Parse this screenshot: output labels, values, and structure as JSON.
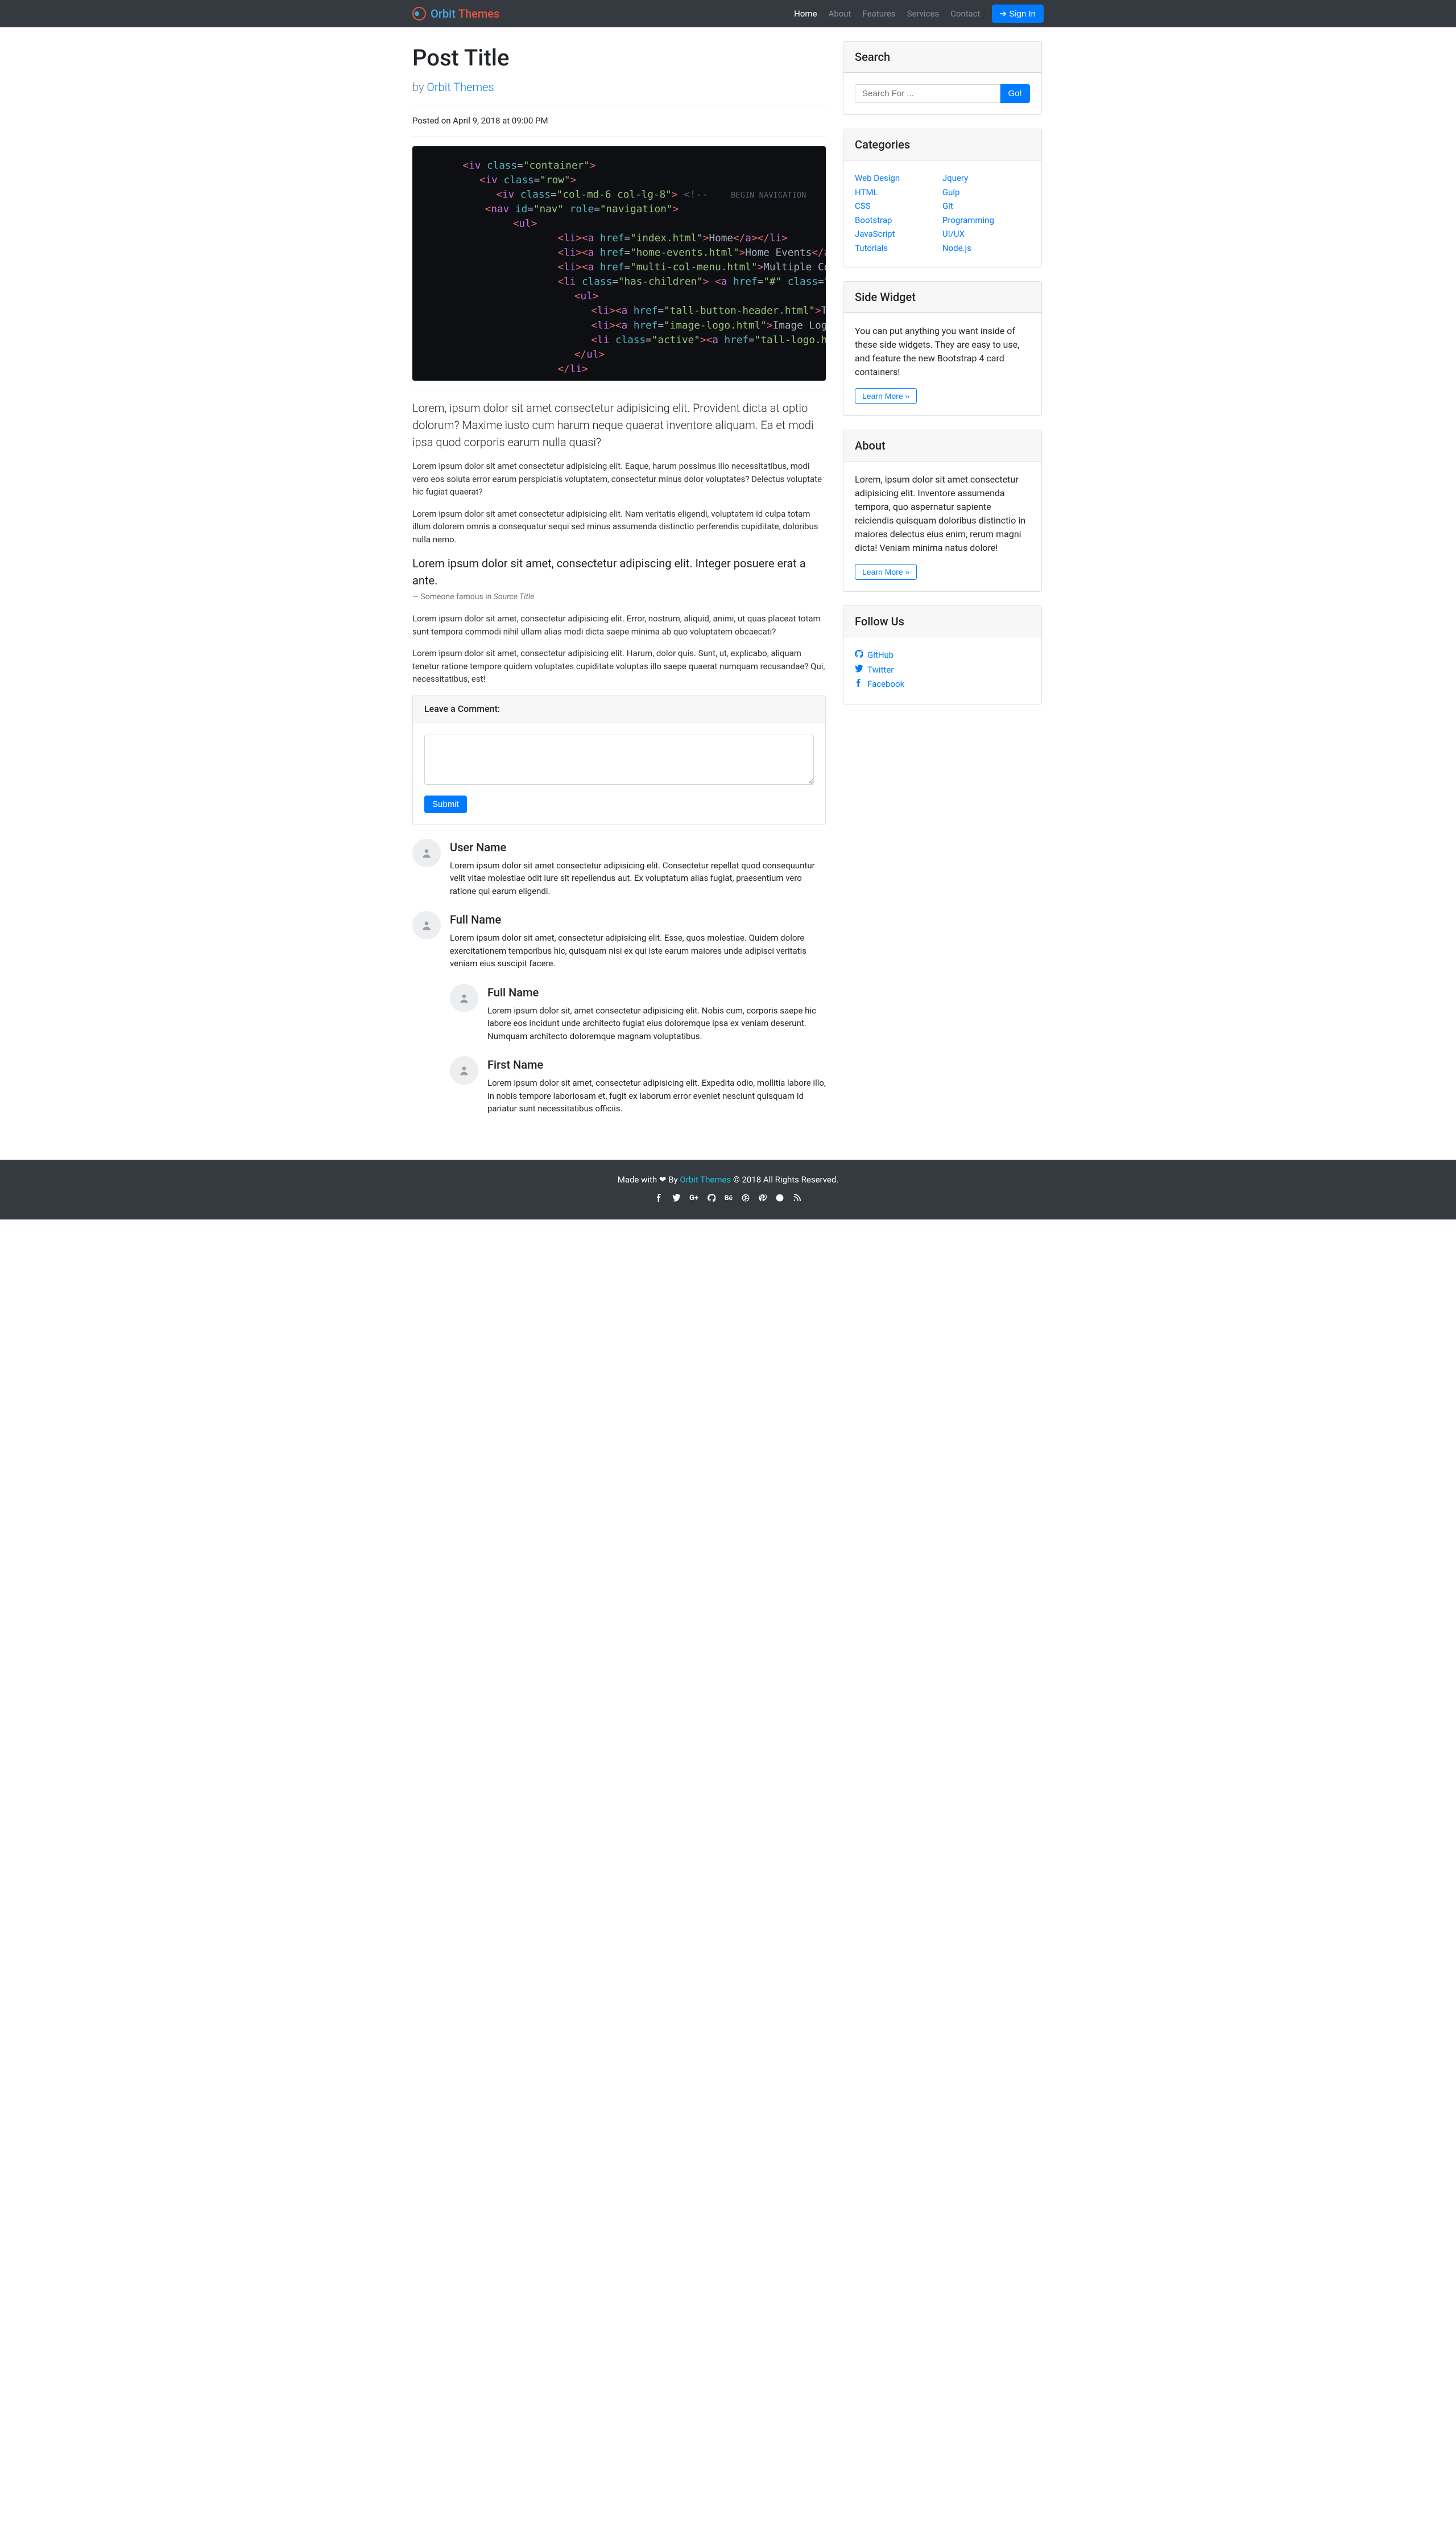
{
  "brand": {
    "orbit": "Orbit",
    "themes": "Themes"
  },
  "nav": {
    "items": [
      {
        "label": "Home",
        "active": true
      },
      {
        "label": "About",
        "active": false
      },
      {
        "label": "Features",
        "active": false
      },
      {
        "label": "Services",
        "active": false
      },
      {
        "label": "Contact",
        "active": false
      }
    ],
    "signin": "Sign In"
  },
  "post": {
    "title": "Post Title",
    "by_prefix": "by ",
    "author": "Orbit Themes",
    "posted": "Posted on April 9, 2018 at 09:00 PM",
    "lead": "Lorem, ipsum dolor sit amet consectetur adipisicing elit. Provident dicta at optio dolorum? Maxime iusto cum harum neque quaerat inventore aliquam. Ea et modi ipsa quod corporis earum nulla quasi?",
    "p1": "Lorem ipsum dolor sit amet consectetur adipisicing elit. Eaque, harum possimus illo necessitatibus, modi vero eos soluta error earum perspiciatis voluptatem, consectetur minus dolor voluptates? Delectus voluptate hic fugiat quaerat?",
    "p2": "Lorem ipsum dolor sit amet consectetur adipisicing elit. Nam veritatis eligendi, voluptatem id culpa totam illum dolorem omnis a consequatur sequi sed minus assumenda distinctio perferendis cupiditate, doloribus nulla nemo.",
    "bq": "Lorem ipsum dolor sit amet, consectetur adipiscing elit. Integer posuere erat a ante.",
    "bq_prefix": "Someone famous in ",
    "bq_cite": "Source Title",
    "p3": "Lorem ipsum dolor sit amet, consectetur adipisicing elit. Error, nostrum, aliquid, animi, ut quas placeat totam sunt tempora commodi nihil ullam alias modi dicta saepe minima ab quo voluptatem obcaecati?",
    "p4": "Lorem ipsum dolor sit amet, consectetur adipisicing elit. Harum, dolor quis. Sunt, ut, explicabo, aliquam tenetur ratione tempore quidem voluptates cupiditate voluptas illo saepe quaerat numquam recusandae? Qui, necessitatibus, est!"
  },
  "comment_form": {
    "header": "Leave a Comment:",
    "submit": "Submit"
  },
  "comments": [
    {
      "name": "User Name",
      "text": "Lorem ipsum dolor sit amet consectetur adipisicing elit. Consectetur repellat quod consequuntur velit vitae molestiae odit iure sit repellendus aut. Ex voluptatum alias fugiat, praesentium vero ratione qui earum eligendi.",
      "replies": []
    },
    {
      "name": "Full Name",
      "text": "Lorem ipsum dolor sit amet, consectetur adipisicing elit. Esse, quos molestiae. Quidem dolore exercitationem temporibus hic, quisquam nisi ex qui iste earum maiores unde adipisci veritatis veniam eius suscipit facere.",
      "replies": [
        {
          "name": "Full Name",
          "text": "Lorem ipsum dolor sit, amet consectetur adipisicing elit. Nobis cum, corporis saepe hic labore eos incidunt unde architecto fugiat eius doloremque ipsa ex veniam deserunt. Numquam architecto doloremque magnam voluptatibus."
        },
        {
          "name": "First Name",
          "text": "Lorem ipsum dolor sit amet, consectetur adipisicing elit. Expedita odio, mollitia labore illo, in nobis tempore laboriosam et, fugit ex laborum error eveniet nesciunt quisquam id pariatur sunt necessitatibus officiis."
        }
      ]
    }
  ],
  "search": {
    "header": "Search",
    "placeholder": "Search For ...",
    "go": "Go!"
  },
  "categories": {
    "header": "Categories",
    "col1": [
      "Web Design",
      "HTML",
      "CSS",
      "Bootstrap",
      "JavaScript",
      "Tutorials"
    ],
    "col2": [
      "Jquery",
      "Gulp",
      "Git",
      "Programming",
      "UI/UX",
      "Node.js"
    ]
  },
  "widget": {
    "header": "Side Widget",
    "text": "You can put anything you want inside of these side widgets. They are easy to use, and feature the new Bootstrap 4 card containers!",
    "learn": "Learn More »"
  },
  "about": {
    "header": "About",
    "text": "Lorem, ipsum dolor sit amet consectetur adipisicing elit. Inventore assumenda tempora, quo aspernatur sapiente reiciendis quisquam doloribus distinctio in maiores delectus eius enim, rerum magni dicta! Veniam minima natus dolore!",
    "learn": "Learn More »"
  },
  "follow": {
    "header": "Follow Us",
    "items": [
      {
        "icon": "github",
        "label": "GitHub"
      },
      {
        "icon": "twitter",
        "label": "Twitter"
      },
      {
        "icon": "facebook",
        "label": "Facebook"
      }
    ]
  },
  "footer": {
    "prefix": "Made with ",
    "heart": "❤",
    "by": " By ",
    "brand": "Orbit Themes",
    "rest": " © 2018 All Rights Reserved."
  }
}
